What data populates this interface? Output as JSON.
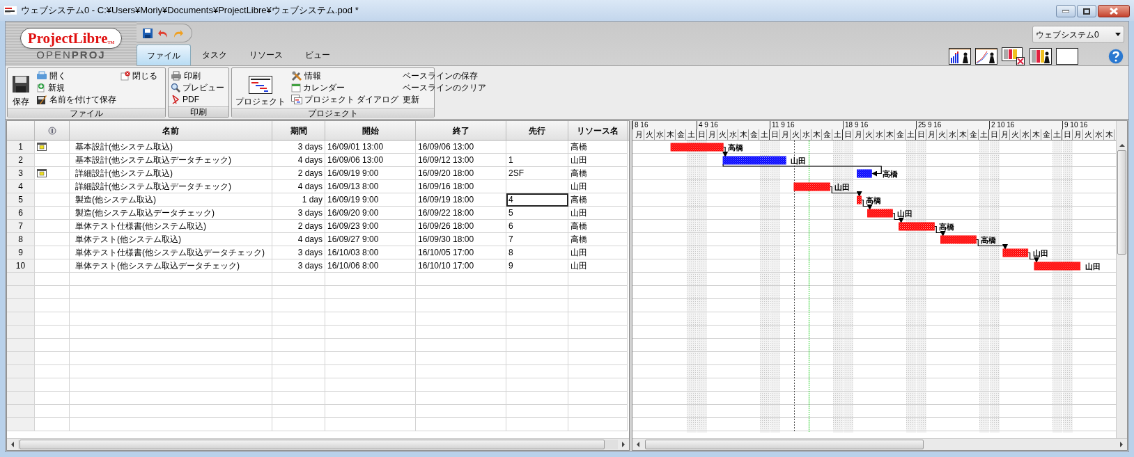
{
  "window": {
    "title": "ウェブシステム0 - C:¥Users¥Moriy¥Documents¥ProjectLibre¥ウェブシステム.pod *"
  },
  "logo": {
    "name": "Project**Libre**$_{TM}$",
    "subtitle": "OPEN**PROJ**"
  },
  "project_selector": {
    "value": "ウェブシステム0"
  },
  "tabs": [
    {
      "label": "ファイル",
      "selected": true
    },
    {
      "label": "タスク",
      "selected": false
    },
    {
      "label": "リソース",
      "selected": false
    },
    {
      "label": "ビュー",
      "selected": false
    }
  ],
  "ribbon_groups": [
    {
      "title": "ファイル",
      "columns": [
        [
          {
            "label": "保存",
            "kind": "large"
          }
        ],
        [
          {
            "label": "開く",
            "kind": "small"
          },
          {
            "label": "新規",
            "kind": "small"
          },
          {
            "label": "名前を付けて保存",
            "kind": "small"
          }
        ],
        [
          {
            "label": "閉じる",
            "kind": "small"
          }
        ]
      ]
    },
    {
      "title": "印刷",
      "columns": [
        [
          {
            "label": "印刷",
            "kind": "small"
          },
          {
            "label": "プレビュー",
            "kind": "small"
          },
          {
            "label": "PDF",
            "kind": "small"
          }
        ]
      ]
    },
    {
      "title": "プロジェクト",
      "columns": [
        [
          {
            "label": "プロジェクト",
            "kind": "large"
          }
        ],
        [
          {
            "label": "情報",
            "kind": "small"
          },
          {
            "label": "カレンダー",
            "kind": "small"
          },
          {
            "label": "プロジェクト ダイアログ",
            "kind": "small"
          }
        ],
        [
          {
            "label": "ベースラインの保存",
            "kind": "small"
          },
          {
            "label": "ベースラインのクリア",
            "kind": "small"
          },
          {
            "label": "更新",
            "kind": "small"
          }
        ]
      ]
    }
  ],
  "table": {
    "columns": [
      "名前",
      "期間",
      "開始",
      "終了",
      "先行",
      "リソース名"
    ],
    "rows": [
      {
        "id": "1",
        "indicator": true,
        "name": "基本設計(他システム取込)",
        "duration": "3 days",
        "start": "16/09/01 13:00",
        "finish": "16/09/06 13:00",
        "resource": "高橋",
        "predecessor_selected": false
      },
      {
        "id": "2",
        "indicator": false,
        "name": "基本設計(他システム取込データチェック)",
        "duration": "4 days",
        "start": "16/09/06 13:00",
        "finish": "16/09/12 13:00",
        "predecessors": "1",
        "resource": "山田",
        "predecessor_selected": false
      },
      {
        "id": "3",
        "indicator": true,
        "name": "詳細設計(他システム取込)",
        "duration": "2 days",
        "start": "16/09/19 9:00",
        "finish": "16/09/20 18:00",
        "predecessors": "2SF",
        "resource": "高橋",
        "predecessor_selected": false
      },
      {
        "id": "4",
        "indicator": false,
        "name": "詳細設計(他システム取込データチェック)",
        "duration": "4 days",
        "start": "16/09/13 8:00",
        "finish": "16/09/16 18:00",
        "resource": "山田",
        "predecessor_selected": false
      },
      {
        "id": "5",
        "indicator": false,
        "name": "製造(他システム取込)",
        "duration": "1 day",
        "start": "16/09/19 9:00",
        "finish": "16/09/19 18:00",
        "predecessors": "4",
        "resource": "高橋",
        "predecessor_selected": true
      },
      {
        "id": "6",
        "indicator": false,
        "name": "製造(他システム取込データチェック)",
        "duration": "3 days",
        "start": "16/09/20 9:00",
        "finish": "16/09/22 18:00",
        "predecessors": "5",
        "resource": "山田",
        "predecessor_selected": false
      },
      {
        "id": "7",
        "indicator": false,
        "name": "単体テスト仕様書(他システム取込)",
        "duration": "2 days",
        "start": "16/09/23 9:00",
        "finish": "16/09/26 18:00",
        "predecessors": "6",
        "resource": "高橋",
        "predecessor_selected": false
      },
      {
        "id": "8",
        "indicator": false,
        "name": "単体テスト(他システム取込)",
        "duration": "4 days",
        "start": "16/09/27 9:00",
        "finish": "16/09/30 18:00",
        "predecessors": "7",
        "resource": "高橋",
        "predecessor_selected": false
      },
      {
        "id": "9",
        "indicator": false,
        "name": "単体テスト仕様書(他システム取込データチェック)",
        "duration": "3 days",
        "start": "16/10/03 8:00",
        "finish": "16/10/05 17:00",
        "predecessors": "8",
        "resource": "山田",
        "predecessor_selected": false
      },
      {
        "id": "10",
        "indicator": false,
        "name": "単体テスト(他システム取込データチェック)",
        "duration": "3 days",
        "start": "16/10/06 8:00",
        "finish": "16/10/10 17:00",
        "predecessors": "9",
        "resource": "山田",
        "predecessor_selected": false
      }
    ]
  },
  "gantt": {
    "weeks": [
      "8 16",
      "4 9 16",
      "11 9 16",
      "18 9 16",
      "25 9 16",
      "2 10 16",
      "9 10 16"
    ],
    "days": [
      "月",
      "火",
      "水",
      "木",
      "金",
      "土",
      "日",
      "月",
      "火",
      "水",
      "木",
      "金",
      "土",
      "日",
      "月",
      "火",
      "水",
      "木",
      "金",
      "土",
      "日",
      "月",
      "火",
      "水",
      "木",
      "金",
      "土",
      "日",
      "月",
      "火",
      "水",
      "木",
      "金",
      "土",
      "日",
      "月",
      "火",
      "水",
      "木",
      "金",
      "土",
      "日",
      "月",
      "火",
      "水",
      "木"
    ],
    "bars": [
      {
        "label": "高橋",
        "color": "#ff0000"
      },
      {
        "label": "山田",
        "color": "#0000ff"
      },
      {
        "label": "高橋",
        "color": "#0000ff"
      },
      {
        "label": "山田",
        "color": "#ff0000"
      },
      {
        "label": "高橋",
        "color": "#ff0000"
      },
      {
        "label": "山田",
        "color": "#ff0000"
      },
      {
        "label": "高橋",
        "color": "#ff0000"
      },
      {
        "label": "高橋",
        "color": "#ff0000"
      },
      {
        "label": "山田",
        "color": "#ff0000"
      },
      {
        "label": "山田",
        "color": "#ff0000"
      }
    ]
  }
}
